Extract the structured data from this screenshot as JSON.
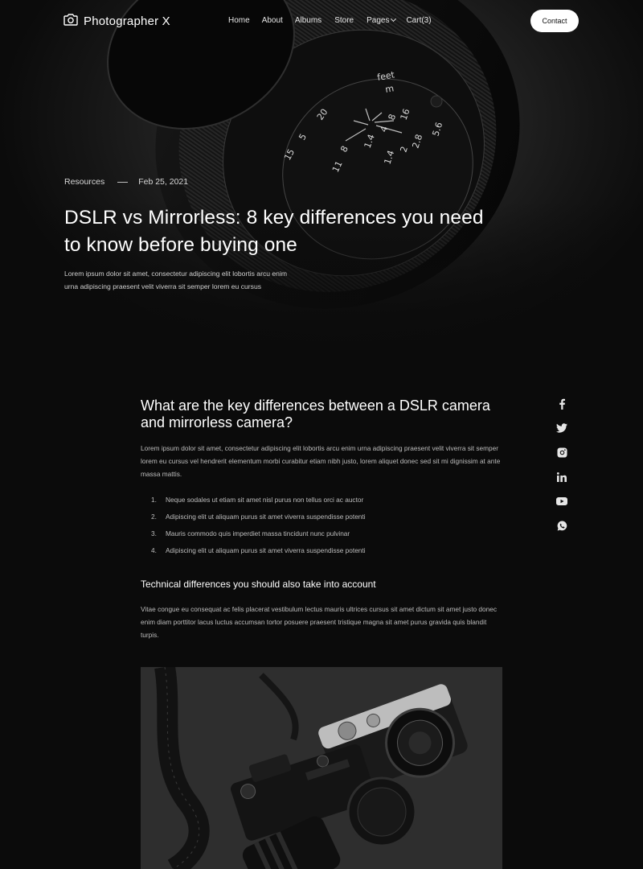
{
  "brand": {
    "name": "Photographer X",
    "logo_icon": "camera-icon"
  },
  "nav": {
    "items": [
      {
        "label": "Home"
      },
      {
        "label": "About"
      },
      {
        "label": "Albums"
      },
      {
        "label": "Store"
      },
      {
        "label": "Pages"
      },
      {
        "label": "Cart(3)"
      }
    ],
    "contact_label": "Contact"
  },
  "hero": {
    "category": "Resources",
    "date": "Feb 25, 2021",
    "title": "DSLR vs Mirrorless: 8 key differences you need to know before buying one",
    "subtitle": "Lorem ipsum dolor sit amet, consectetur adipiscing elit lobortis arcu enim urna adipiscing praesent velit viverra sit semper lorem eu cursus"
  },
  "article": {
    "heading": "What are the key differences between a DSLR camera and mirrorless camera?",
    "intro": "Lorem ipsum dolor sit amet, consectetur adipiscing elit lobortis arcu enim urna adipiscing praesent velit viverra sit semper lorem eu cursus vel hendrerit elementum morbi curabitur etiam nibh justo, lorem aliquet donec sed sit mi dignissim at ante massa mattis.",
    "list": [
      {
        "num": "1.",
        "text": "Neque sodales ut etiam sit amet nisl purus non tellus orci ac auctor"
      },
      {
        "num": "2.",
        "text": "Adipiscing elit ut aliquam purus sit amet viverra suspendisse potenti"
      },
      {
        "num": "3.",
        "text": "Mauris commodo quis imperdiet massa tincidunt nunc pulvinar"
      },
      {
        "num": "4.",
        "text": "Adipiscing elit ut aliquam purus sit amet viverra suspendisse potenti"
      }
    ],
    "subheading": "Technical differences you should also take into account",
    "body": "Vitae congue eu consequat ac felis placerat vestibulum lectus mauris ultrices cursus sit amet dictum sit amet justo donec enim diam porttitor lacus luctus accumsan tortor posuere praesent tristique magna sit amet purus gravida quis blandit turpis."
  },
  "social": [
    "facebook-icon",
    "twitter-icon",
    "instagram-icon",
    "linkedin-icon",
    "youtube-icon",
    "whatsapp-icon"
  ],
  "colors": {
    "background": "#0b0b0b",
    "text": "#ffffff",
    "muted": "#bdbdbd",
    "button_bg": "#ffffff",
    "button_text": "#111111"
  }
}
